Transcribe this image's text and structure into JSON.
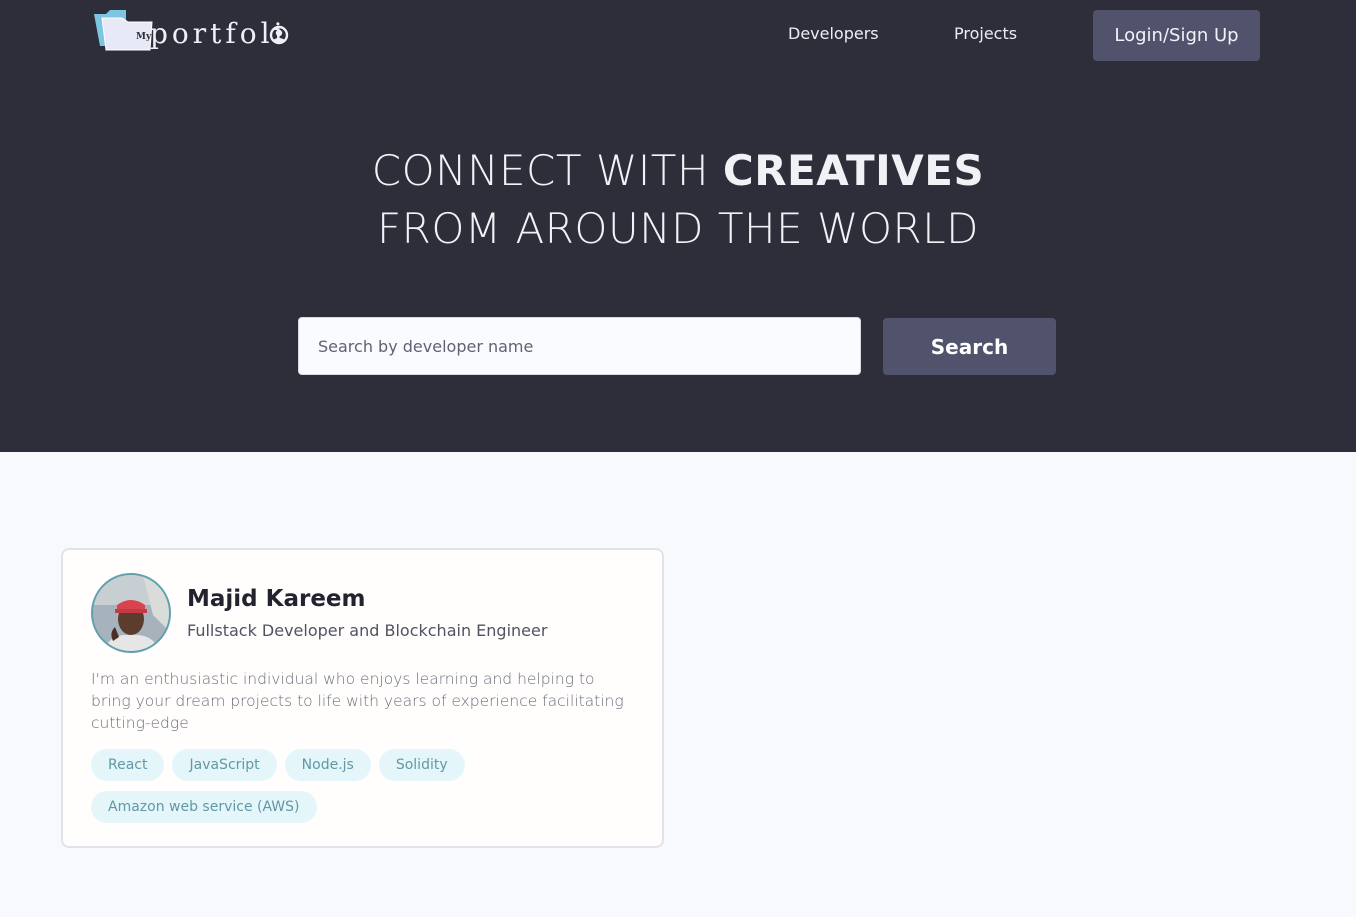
{
  "header": {
    "logo": {
      "small_text": "My",
      "text": "portfoli"
    },
    "nav": {
      "developers": "Developers",
      "projects": "Projects"
    },
    "login_label": "Login/Sign Up"
  },
  "hero": {
    "line1_prefix": "CONNECT WITH ",
    "line1_bold": "CREATIVES",
    "line2": "FROM AROUND THE WORLD"
  },
  "search": {
    "placeholder": "Search by developer name",
    "value": "",
    "button_label": "Search"
  },
  "developers": [
    {
      "name": "Majid Kareem",
      "title": "Fullstack Developer and Blockchain Engineer",
      "bio": "I'm an enthusiastic individual who enjoys learning and helping to bring your dream projects to life with years of experience facilitating cutting-edge",
      "skills": [
        "React",
        "JavaScript",
        "Node.js",
        "Solidity",
        "Amazon web service (AWS)"
      ]
    }
  ],
  "colors": {
    "hero_background": "#2e2e3b",
    "button": "#51536d",
    "page_background": "#f8f9fd",
    "tag_background": "#e5f6fa",
    "tag_text": "#5f99a6"
  }
}
